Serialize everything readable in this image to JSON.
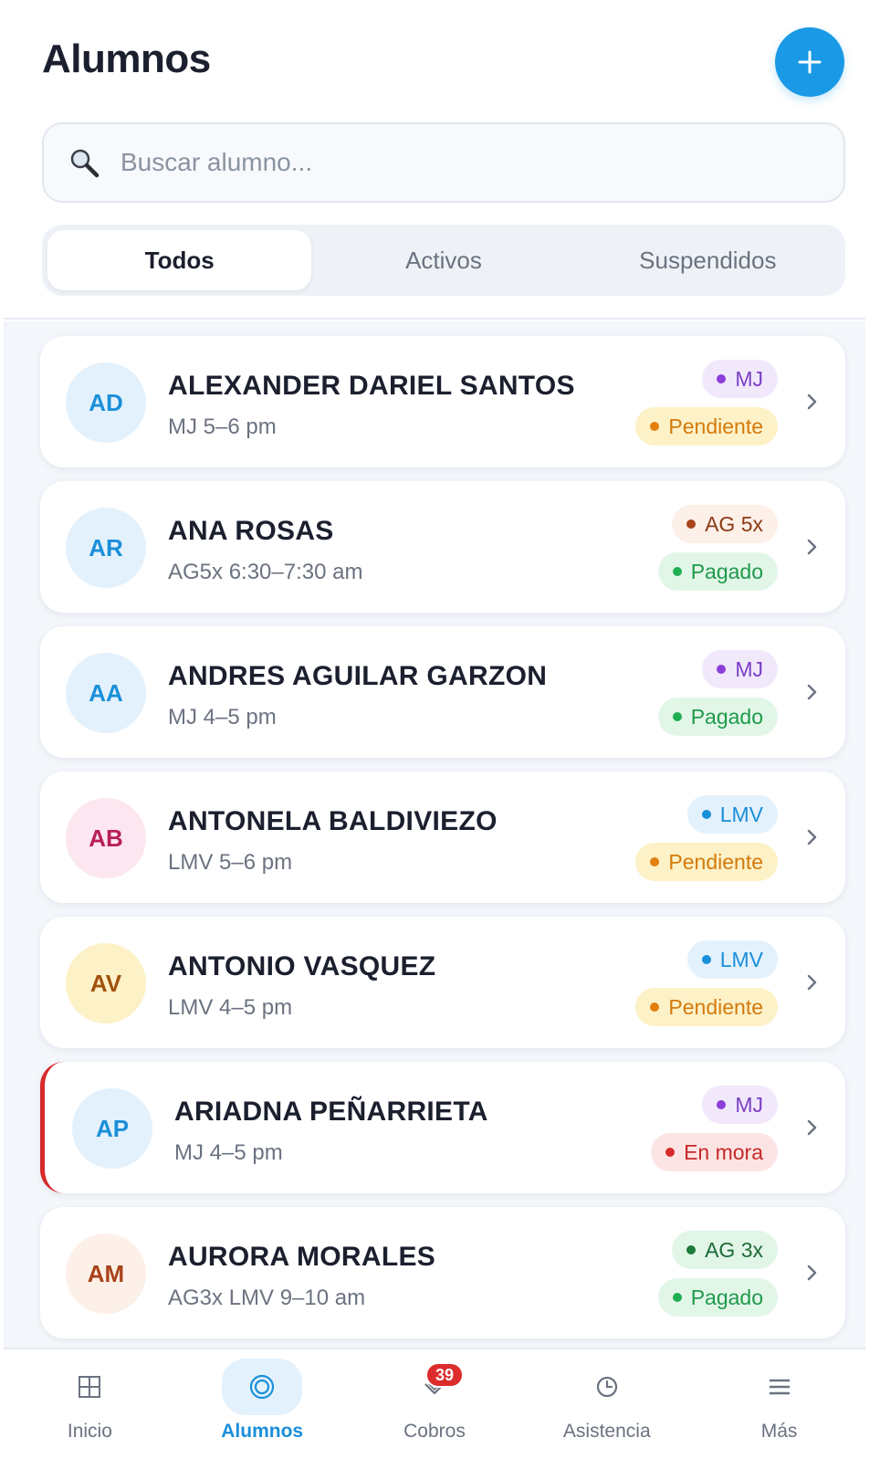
{
  "header": {
    "title": "Alumnos",
    "add_icon": "plus-icon",
    "search_placeholder": "Buscar alumno...",
    "search_icon": "magnifier-icon"
  },
  "tabs": [
    {
      "label": "Todos",
      "active": true
    },
    {
      "label": "Activos",
      "active": false
    },
    {
      "label": "Suspendidos",
      "active": false
    }
  ],
  "students": [
    {
      "initials": "AD",
      "name": "ALEXANDER DARIEL SANTOS",
      "schedule": "MJ 5–6 pm",
      "group": "MJ",
      "status": "Pendiente",
      "avatar_bg": "#e3f1fc",
      "avatar_fg": "#1a8fd9",
      "group_bg": "#f1e8fc",
      "group_fg": "#7b3fc4",
      "group_dot": "#8b3fd9",
      "status_bg": "#fdf1c7",
      "status_fg": "#d47a0c",
      "status_dot": "#e27f0f",
      "alert": false
    },
    {
      "initials": "AR",
      "name": "ANA ROSAS",
      "schedule": "AG5x 6:30–7:30 am",
      "group": "AG 5x",
      "status": "Pagado",
      "avatar_bg": "#e3f1fc",
      "avatar_fg": "#1a8fd9",
      "group_bg": "#fdf0e8",
      "group_fg": "#8b3a14",
      "group_dot": "#a8431a",
      "status_bg": "#e2f6e8",
      "status_fg": "#1f9a4a",
      "status_dot": "#1fae52",
      "alert": false
    },
    {
      "initials": "AA",
      "name": "ANDRES AGUILAR GARZON",
      "schedule": "MJ 4–5 pm",
      "group": "MJ",
      "status": "Pagado",
      "avatar_bg": "#e3f1fc",
      "avatar_fg": "#1a8fd9",
      "group_bg": "#f1e8fc",
      "group_fg": "#7b3fc4",
      "group_dot": "#8b3fd9",
      "status_bg": "#e2f6e8",
      "status_fg": "#1f9a4a",
      "status_dot": "#1fae52",
      "alert": false
    },
    {
      "initials": "AB",
      "name": "ANTONELA BALDIVIEZO",
      "schedule": "LMV 5–6 pm",
      "group": "LMV",
      "status": "Pendiente",
      "avatar_bg": "#fce6ef",
      "avatar_fg": "#b81e55",
      "group_bg": "#e3f1fc",
      "group_fg": "#1a8fd9",
      "group_dot": "#1a8fd9",
      "status_bg": "#fdf1c7",
      "status_fg": "#d47a0c",
      "status_dot": "#e27f0f",
      "alert": false
    },
    {
      "initials": "AV",
      "name": "ANTONIO VASQUEZ",
      "schedule": "LMV 4–5 pm",
      "group": "LMV",
      "status": "Pendiente",
      "avatar_bg": "#fdf1c7",
      "avatar_fg": "#a0520c",
      "group_bg": "#e3f1fc",
      "group_fg": "#1a8fd9",
      "group_dot": "#1a8fd9",
      "status_bg": "#fdf1c7",
      "status_fg": "#d47a0c",
      "status_dot": "#e27f0f",
      "alert": false
    },
    {
      "initials": "AP",
      "name": "ARIADNA PEÑARRIETA",
      "schedule": "MJ 4–5 pm",
      "group": "MJ",
      "status": "En mora",
      "avatar_bg": "#e3f1fc",
      "avatar_fg": "#1a8fd9",
      "group_bg": "#f1e8fc",
      "group_fg": "#7b3fc4",
      "group_dot": "#8b3fd9",
      "status_bg": "#fde4e4",
      "status_fg": "#c62828",
      "status_dot": "#d62b2b",
      "alert": true
    },
    {
      "initials": "AM",
      "name": "AURORA MORALES",
      "schedule": "AG3x LMV 9–10 am",
      "group": "AG 3x",
      "status": "Pagado",
      "avatar_bg": "#fdf0e8",
      "avatar_fg": "#a8431a",
      "group_bg": "#e2f6e8",
      "group_fg": "#1c6b35",
      "group_dot": "#1c7a3a",
      "status_bg": "#e2f6e8",
      "status_fg": "#1f9a4a",
      "status_dot": "#1fae52",
      "alert": false
    }
  ],
  "nav": [
    {
      "label": "Inicio",
      "icon": "grid-icon",
      "active": false,
      "badge": ""
    },
    {
      "label": "Alumnos",
      "icon": "users-circle-icon",
      "active": true,
      "badge": ""
    },
    {
      "label": "Cobros",
      "icon": "payments-icon",
      "active": false,
      "badge": "39"
    },
    {
      "label": "Asistencia",
      "icon": "clock-icon",
      "active": false,
      "badge": ""
    },
    {
      "label": "Más",
      "icon": "menu-icon",
      "active": false,
      "badge": ""
    }
  ],
  "colors": {
    "accent": "#1a9ae6",
    "alert": "#d62b2b"
  }
}
